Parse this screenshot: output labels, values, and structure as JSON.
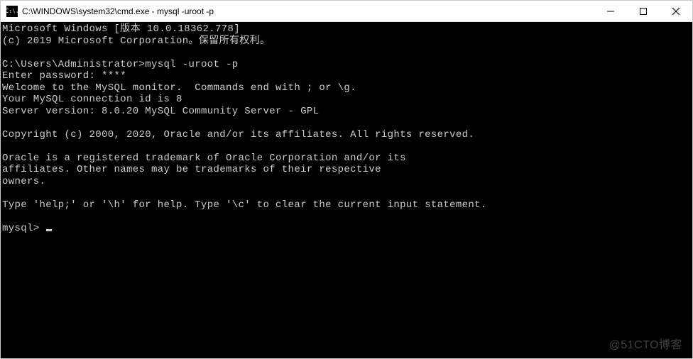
{
  "titlebar": {
    "icon_label": "C:\\.",
    "title": "C:\\WINDOWS\\system32\\cmd.exe - mysql  -uroot -p"
  },
  "terminal": {
    "lines": [
      "Microsoft Windows [版本 10.0.18362.778]",
      "(c) 2019 Microsoft Corporation。保留所有权利。",
      "",
      "C:\\Users\\Administrator>mysql -uroot -p",
      "Enter password: ****",
      "Welcome to the MySQL monitor.  Commands end with ; or \\g.",
      "Your MySQL connection id is 8",
      "Server version: 8.0.20 MySQL Community Server - GPL",
      "",
      "Copyright (c) 2000, 2020, Oracle and/or its affiliates. All rights reserved.",
      "",
      "Oracle is a registered trademark of Oracle Corporation and/or its",
      "affiliates. Other names may be trademarks of their respective",
      "owners.",
      "",
      "Type 'help;' or '\\h' for help. Type '\\c' to clear the current input statement.",
      ""
    ],
    "prompt": "mysql> "
  },
  "watermark": "@51CTO博客"
}
